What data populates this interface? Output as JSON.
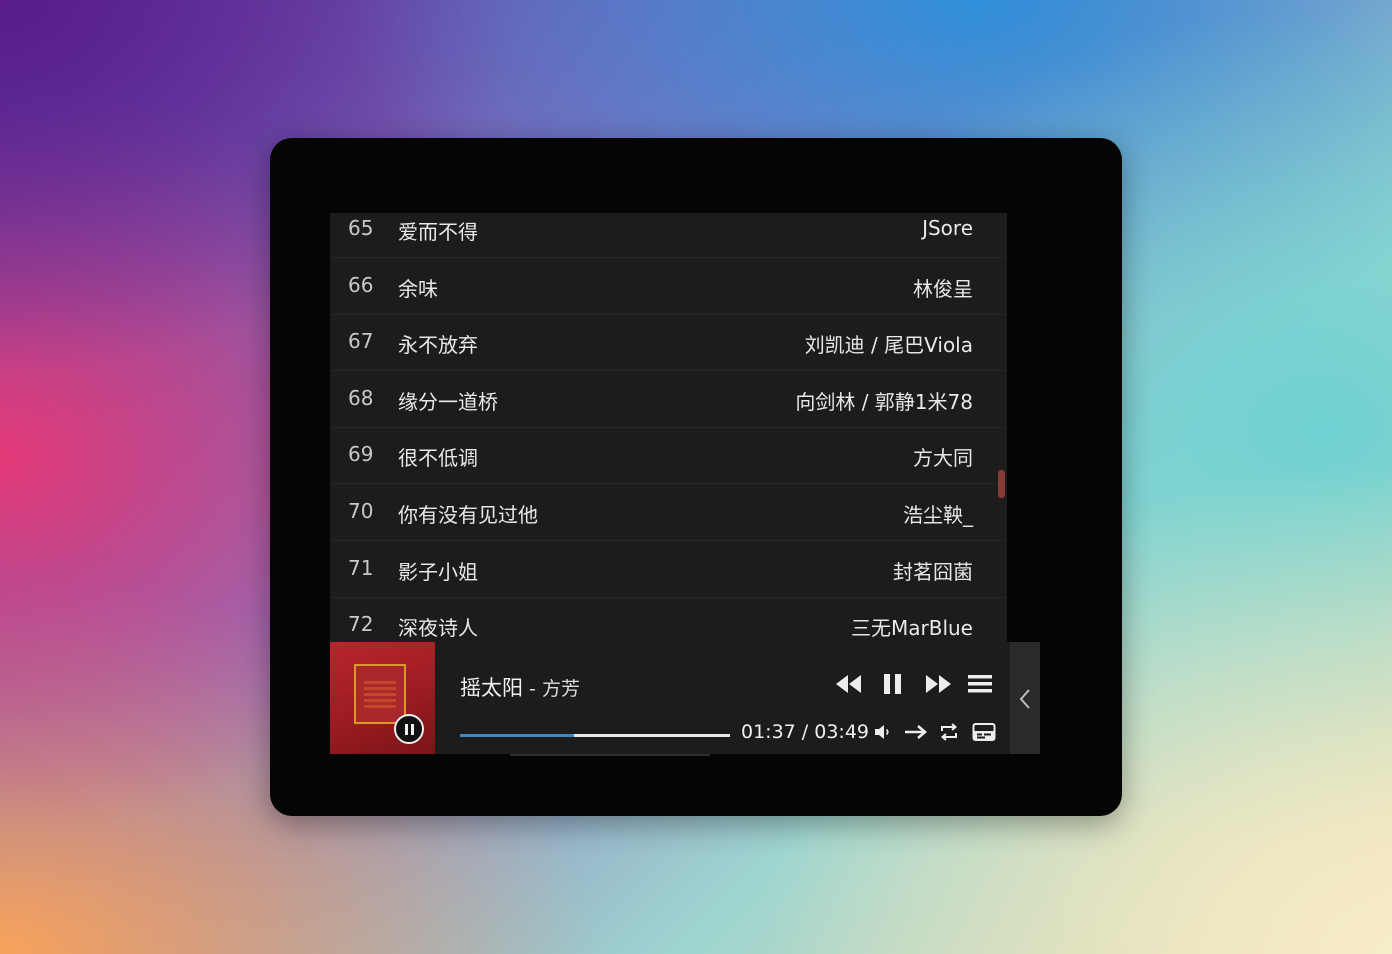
{
  "playlist": {
    "songs": [
      {
        "no": "65",
        "title": "爱而不得",
        "artist": "JSore"
      },
      {
        "no": "66",
        "title": "余味",
        "artist": "林俊呈"
      },
      {
        "no": "67",
        "title": "永不放弃",
        "artist": "刘凯迪 / 尾巴Viola"
      },
      {
        "no": "68",
        "title": "缘分一道桥",
        "artist": "向剑林 / 郭静1米78"
      },
      {
        "no": "69",
        "title": "很不低调",
        "artist": "方大同"
      },
      {
        "no": "70",
        "title": "你有没有见过他",
        "artist": "浩尘鞅_"
      },
      {
        "no": "71",
        "title": "影子小姐",
        "artist": "封茗囧菌"
      },
      {
        "no": "72",
        "title": "深夜诗人",
        "artist": "三无MarBlue"
      }
    ],
    "scroll_position": 0.62
  },
  "player": {
    "title": "摇太阳",
    "separator": " - ",
    "artist": "方芳",
    "current_time": "01:37",
    "duration": "03:49",
    "time_display": "01:37 / 03:49",
    "progress": 0.424,
    "buffered": 0.83,
    "state": "playing",
    "icons": {
      "prev": "skip-back-icon",
      "pause": "pause-icon",
      "next": "skip-forward-icon",
      "menu": "menu-icon",
      "volume": "volume-icon",
      "order": "order-icon",
      "loop": "loop-icon",
      "lyrics": "lyrics-icon",
      "toggle": "chevron-left-icon"
    },
    "colors": {
      "accent": "#3b88c6",
      "scrollbar": "#8a3a36"
    }
  }
}
